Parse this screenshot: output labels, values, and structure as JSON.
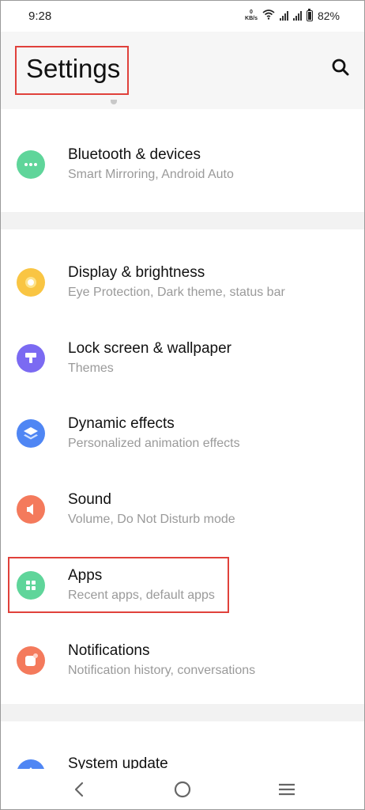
{
  "status": {
    "time": "9:28",
    "net_speed_value": "0",
    "net_speed_unit": "KB/s",
    "battery": "82%"
  },
  "header": {
    "title": "Settings",
    "search_icon": "search-icon"
  },
  "colors": {
    "highlight": "#e0413b",
    "bluetooth": "#5fd59a",
    "display": "#f9c543",
    "lock_screen": "#7b6af2",
    "dynamic_effects": "#4f86f4",
    "sound": "#f47a5c",
    "apps": "#5fd59a",
    "notifications": "#f47a5c",
    "system_update": "#4f86f4"
  },
  "settings": {
    "bluetooth": {
      "label": "Bluetooth & devices",
      "sub": "Smart Mirroring, Android Auto",
      "icon": "more-dots-icon"
    },
    "display": {
      "label": "Display & brightness",
      "sub": "Eye Protection, Dark theme, status bar",
      "icon": "brightness-icon"
    },
    "lock_screen": {
      "label": "Lock screen & wallpaper",
      "sub": "Themes",
      "icon": "paint-brush-icon"
    },
    "dynamic_effects": {
      "label": "Dynamic effects",
      "sub": "Personalized animation effects",
      "icon": "layers-icon"
    },
    "sound": {
      "label": "Sound",
      "sub": "Volume, Do Not Disturb mode",
      "icon": "speaker-icon"
    },
    "apps": {
      "label": "Apps",
      "sub": "Recent apps, default apps",
      "icon": "apps-grid-icon"
    },
    "notifications": {
      "label": "Notifications",
      "sub": "Notification history, conversations",
      "icon": "notification-icon"
    },
    "system_update": {
      "label": "System update",
      "icon": "update-arrow-icon"
    }
  },
  "nav": {
    "back_icon": "back-chevron-icon",
    "home_icon": "home-circle-icon",
    "menu_icon": "menu-lines-icon"
  }
}
